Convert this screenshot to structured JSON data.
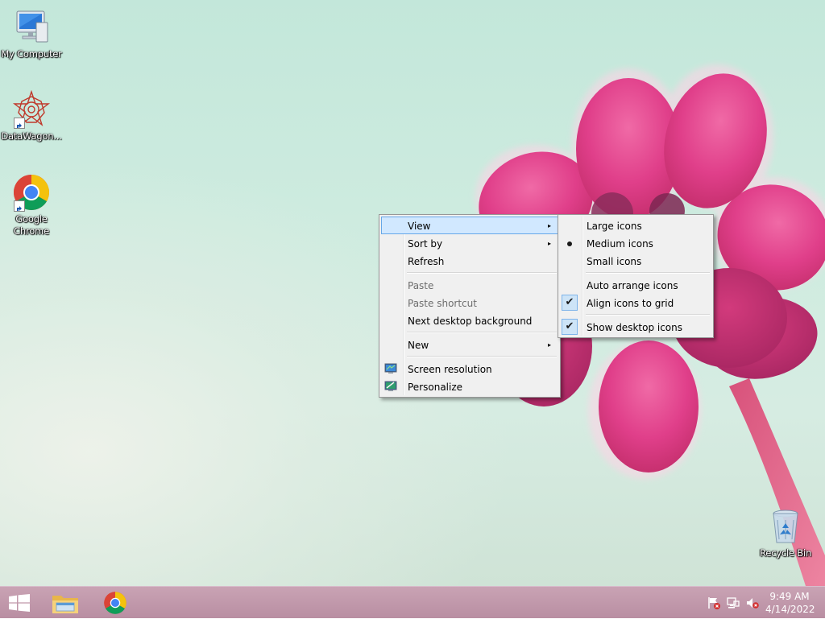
{
  "desktop": {
    "icons": [
      {
        "label": "My Computer",
        "icon": "computer-icon"
      },
      {
        "label": "DataWagon...",
        "icon": "datawagon-icon"
      },
      {
        "label": "Google Chrome",
        "icon": "chrome-icon"
      },
      {
        "label": "Recycle Bin",
        "icon": "recycle-bin-icon"
      }
    ]
  },
  "context_menu": {
    "items": [
      {
        "label": "View",
        "submenu_arrow": "▸",
        "highlighted": true
      },
      {
        "label": "Sort by",
        "submenu_arrow": "▸"
      },
      {
        "label": "Refresh"
      },
      {
        "label": "Paste",
        "disabled": true
      },
      {
        "label": "Paste shortcut",
        "disabled": true
      },
      {
        "label": "Next desktop background"
      },
      {
        "label": "New",
        "submenu_arrow": "▸"
      },
      {
        "label": "Screen resolution",
        "icon": "screen-resolution-icon"
      },
      {
        "label": "Personalize",
        "icon": "personalize-icon"
      }
    ]
  },
  "view_submenu": {
    "items": [
      {
        "label": "Large icons"
      },
      {
        "label": "Medium icons",
        "selected": true,
        "mark": "bullet"
      },
      {
        "label": "Small icons"
      },
      {
        "label": "Auto arrange icons"
      },
      {
        "label": "Align icons to grid",
        "checked": true,
        "mark": "✔"
      },
      {
        "label": "Show desktop icons",
        "checked": true,
        "mark": "✔"
      }
    ]
  },
  "taskbar": {
    "start_icon": "windows-logo-icon",
    "pinned": [
      {
        "icon": "file-explorer-icon"
      },
      {
        "icon": "chrome-icon"
      }
    ],
    "tray": {
      "icons": [
        "action-center-flag-icon",
        "network-icon",
        "volume-muted-icon"
      ],
      "time": "9:49 AM",
      "date": "4/14/2022"
    }
  },
  "colors": {
    "menu_bg": "#f0f0f0",
    "menu_highlight": "#d1e8ff",
    "menu_highlight_border": "#66a7e8",
    "taskbar": "#c29aad",
    "flower_petal": "#e0408a"
  }
}
